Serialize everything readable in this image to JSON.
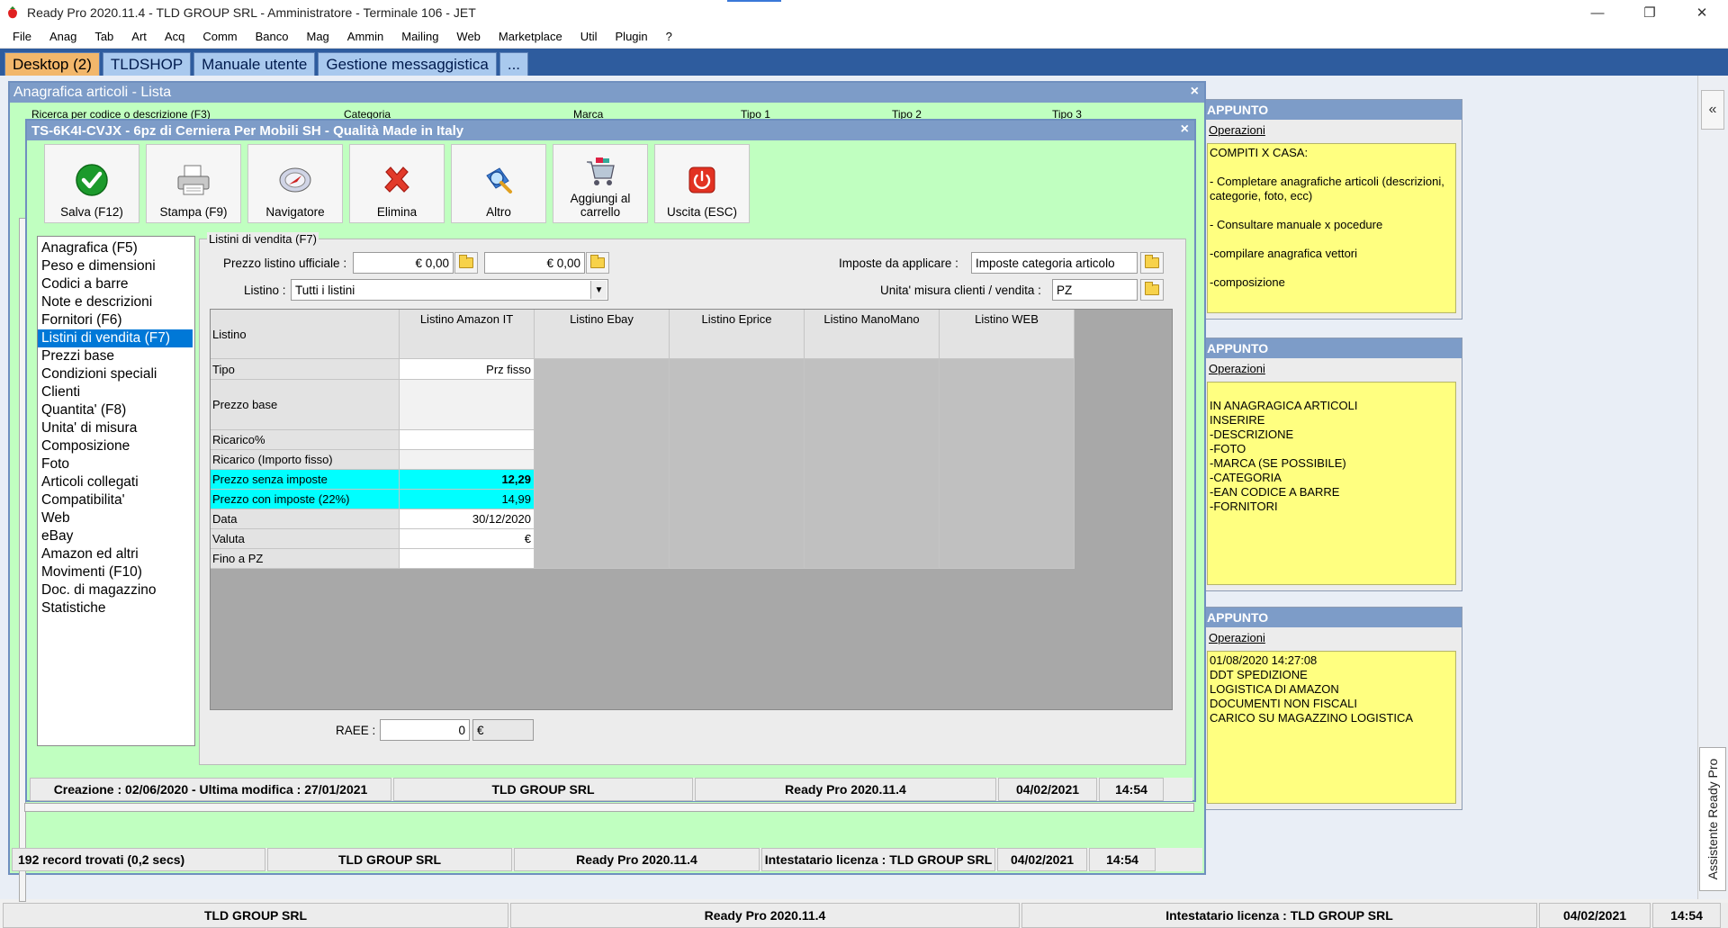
{
  "window": {
    "title": "Ready Pro 2020.11.4 - TLD GROUP SRL - Amministratore - Terminale 106 - JET",
    "minimize": "—",
    "restore": "❐",
    "close": "✕"
  },
  "menu": [
    "File",
    "Anag",
    "Tab",
    "Art",
    "Acq",
    "Comm",
    "Banco",
    "Mag",
    "Ammin",
    "Mailing",
    "Web",
    "Marketplace",
    "Util",
    "Plugin",
    "?"
  ],
  "tabs": [
    "Desktop (2)",
    "TLDSHOP",
    "Manuale utente",
    "Gestione messaggistica",
    "..."
  ],
  "list_window": {
    "title": "Anagrafica articoli  - Lista",
    "close": "×",
    "filters": [
      "Ricerca per codice o descrizione (F3)",
      "Categoria",
      "Marca",
      "Tipo 1",
      "Tipo 2",
      "Tipo 3"
    ],
    "status": {
      "records": "192 record trovati (0,2 secs)",
      "company": "TLD GROUP SRL",
      "version": "Ready Pro 2020.11.4",
      "licensee": "Intestatario licenza : TLD GROUP SRL",
      "date": "04/02/2021",
      "time": "14:54"
    }
  },
  "detail_window": {
    "title": "TS-6K4I-CVJX - 6pz di Cerniera Per Mobili SH - Qualità Made in Italy",
    "close": "×",
    "toolbar": [
      {
        "label": "Salva (F12)",
        "icon": "check-icon"
      },
      {
        "label": "Stampa (F9)",
        "icon": "printer-icon"
      },
      {
        "label": "Navigatore",
        "icon": "compass-icon"
      },
      {
        "label": "Elimina",
        "icon": "delete-x-icon"
      },
      {
        "label": "Altro",
        "icon": "magnifier-icon"
      },
      {
        "label": "Aggiungi al carrello",
        "icon": "cart-icon"
      },
      {
        "label": "Uscita (ESC)",
        "icon": "power-icon"
      }
    ],
    "sidebar": [
      "Anagrafica (F5)",
      "Peso e dimensioni",
      "Codici a barre",
      "Note e descrizioni",
      "Fornitori (F6)",
      "Listini di vendita (F7)",
      "Prezzi base",
      "Condizioni speciali",
      "Clienti",
      "Quantita' (F8)",
      "Unita' di misura",
      "Composizione",
      "Foto",
      "Articoli collegati",
      "Compatibilita'",
      "Web",
      "eBay",
      "Amazon ed altri",
      "Movimenti (F10)",
      "Doc. di magazzino",
      "Statistiche"
    ],
    "sidebar_selected": "Listini di vendita (F7)",
    "group_title": "Listini di vendita (F7)",
    "form": {
      "prezzo_listino_label": "Prezzo listino ufficiale :",
      "prezzo_listino_1": "€ 0,00",
      "prezzo_listino_2": "€ 0,00",
      "imposte_label": "Imposte da applicare :",
      "imposte_value": "Imposte categoria articolo",
      "listino_label": "Listino :",
      "listino_value": "Tutti i listini",
      "unita_label": "Unita' misura clienti / vendita :",
      "unita_value": "PZ",
      "raee_label": "RAEE :",
      "raee_value": "0",
      "raee_unit": "€"
    },
    "grid": {
      "corner": "Listino",
      "columns": [
        "Listino Amazon IT",
        "Listino Ebay",
        "Listino Eprice",
        "Listino ManoMano",
        "Listino WEB"
      ],
      "rows": [
        {
          "label": "Tipo",
          "value": "Prz fisso"
        },
        {
          "label": "Prezzo base",
          "value": ""
        },
        {
          "label": "Ricarico%",
          "value": ""
        },
        {
          "label": "Ricarico (Importo fisso)",
          "value": ""
        },
        {
          "label": "Prezzo senza imposte",
          "value": "12,29"
        },
        {
          "label": "Prezzo con imposte (22%)",
          "value": "14,99"
        },
        {
          "label": "Data",
          "value": "30/12/2020"
        },
        {
          "label": "Valuta",
          "value": "€"
        },
        {
          "label": "Fino a PZ",
          "value": ""
        }
      ]
    },
    "status": {
      "dates": "Creazione : 02/06/2020 - Ultima modifica : 27/01/2021",
      "company": "TLD GROUP SRL",
      "version": "Ready Pro 2020.11.4",
      "date": "04/02/2021",
      "time": "14:54"
    }
  },
  "notes": [
    {
      "title": "APPUNTO",
      "ops": "Operazioni",
      "lines": [
        "COMPITI X CASA:",
        "",
        "- Completare anagrafiche articoli (descrizioni,",
        "categorie, foto, ecc)",
        "",
        "- Consultare manuale x pocedure",
        "",
        "-compilare anagrafica vettori",
        "",
        "-composizione"
      ]
    },
    {
      "title": "APPUNTO",
      "ops": "Operazioni",
      "lines": [
        "",
        "IN ANAGRAGICA ARTICOLI",
        "INSERIRE",
        "-DESCRIZIONE",
        "-FOTO",
        "-MARCA (SE POSSIBILE)",
        "-CATEGORIA",
        "-EAN CODICE A BARRE",
        "-FORNITORI"
      ]
    },
    {
      "title": "APPUNTO",
      "ops": "Operazioni",
      "lines": [
        "01/08/2020 14:27:08",
        "DDT SPEDIZIONE",
        "LOGISTICA DI AMAZON",
        "DOCUMENTI NON FISCALI",
        "CARICO SU MAGAZZINO LOGISTICA"
      ]
    }
  ],
  "assistant_label": "Assistente Ready Pro",
  "rail_toggle": "«",
  "bottom_status": {
    "company": "TLD GROUP SRL",
    "version": "Ready Pro 2020.11.4",
    "licensee": "Intestatario licenza : TLD GROUP SRL",
    "date": "04/02/2021",
    "time": "14:54"
  }
}
